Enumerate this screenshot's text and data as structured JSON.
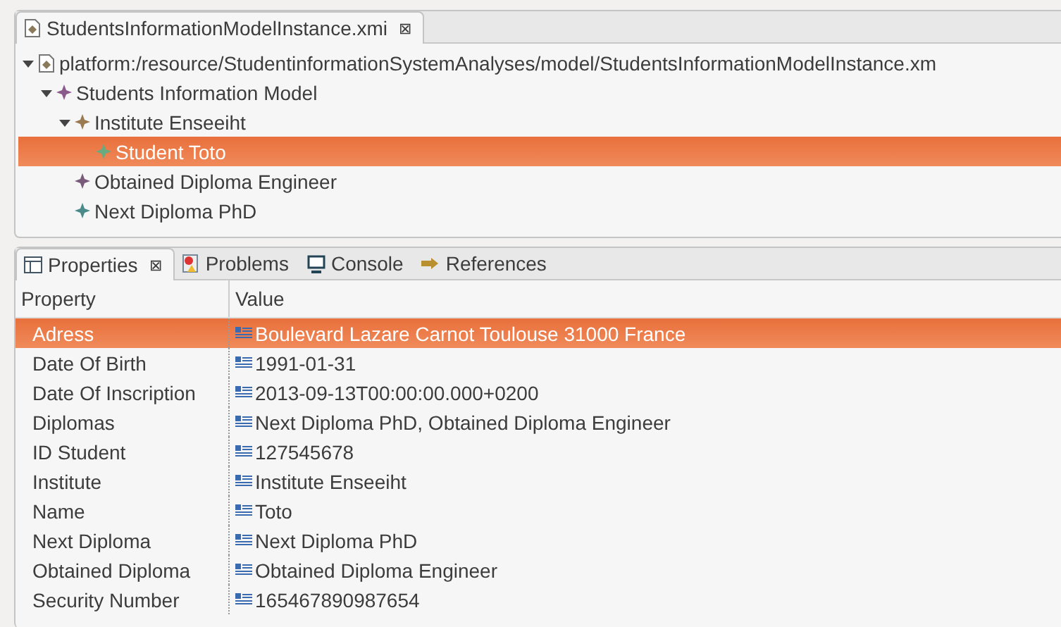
{
  "editor": {
    "tabs": [
      {
        "label": "StudentsInformationModelInstance.xmi",
        "close": "⊠",
        "selected": true
      }
    ],
    "tree": [
      {
        "label": "platform:/resource/StudentinformationSystemAnalyses/model/StudentsInformationModelInstance.xm",
        "kind": "resource",
        "expanded": true,
        "selected": false,
        "children": [
          {
            "label": "Students Information Model",
            "kind": "element",
            "color": "#8a5a8a",
            "expanded": true,
            "selected": false,
            "children": [
              {
                "label": "Institute Enseeiht",
                "kind": "element",
                "color": "#9a7a50",
                "expanded": true,
                "selected": false,
                "children": [
                  {
                    "label": "Student Toto",
                    "kind": "element",
                    "color": "#6aaa80",
                    "expanded": false,
                    "selected": true
                  }
                ]
              },
              {
                "label": "Obtained Diploma Engineer",
                "kind": "element",
                "color": "#7a5a7a",
                "expanded": false,
                "selected": false
              },
              {
                "label": "Next Diploma PhD",
                "kind": "element",
                "color": "#4a8a8a",
                "expanded": false,
                "selected": false
              }
            ]
          }
        ]
      }
    ]
  },
  "views": {
    "tabs": [
      {
        "label": "Properties",
        "kind": "properties",
        "close": "⊠",
        "selected": true
      },
      {
        "label": "Problems",
        "kind": "problems",
        "selected": false
      },
      {
        "label": "Console",
        "kind": "console",
        "selected": false
      },
      {
        "label": "References",
        "kind": "references",
        "selected": false
      }
    ],
    "table": {
      "columns": [
        "Property",
        "Value"
      ],
      "rows": [
        {
          "property": "Adress",
          "value": "Boulevard Lazare Carnot Toulouse 31000 France",
          "selected": true
        },
        {
          "property": "Date Of Birth",
          "value": "1991-01-31",
          "selected": false
        },
        {
          "property": "Date Of Inscription",
          "value": "2013-09-13T00:00:00.000+0200",
          "selected": false
        },
        {
          "property": "Diplomas",
          "value": "Next Diploma PhD, Obtained Diploma Engineer",
          "selected": false
        },
        {
          "property": "ID Student",
          "value": "127545678",
          "selected": false
        },
        {
          "property": "Institute",
          "value": "Institute Enseeiht",
          "selected": false
        },
        {
          "property": "Name",
          "value": "Toto",
          "selected": false
        },
        {
          "property": "Next Diploma",
          "value": "Next Diploma PhD",
          "selected": false
        },
        {
          "property": "Obtained Diploma",
          "value": "Obtained Diploma Engineer",
          "selected": false
        },
        {
          "property": "Security Number",
          "value": "165467890987654",
          "selected": false
        }
      ]
    }
  }
}
